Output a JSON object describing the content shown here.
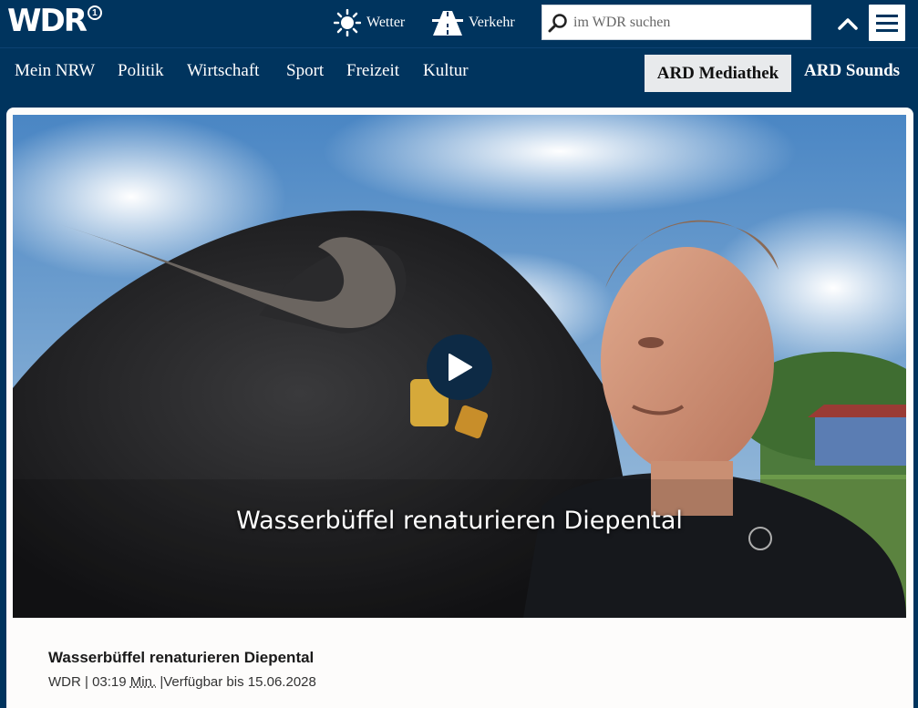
{
  "header": {
    "logo_text": "WDR",
    "logo_badge": "1",
    "services": {
      "weather_label": "Wetter",
      "traffic_label": "Verkehr"
    },
    "search": {
      "placeholder": "im WDR suchen"
    },
    "icons": {
      "weather": "sun-icon",
      "traffic": "highway-icon",
      "search": "magnifier-icon",
      "collapse": "chevron-up-icon",
      "menu": "hamburger-menu-icon"
    }
  },
  "nav": {
    "items": [
      {
        "label": "Mein NRW"
      },
      {
        "label": "Politik"
      },
      {
        "label": "Wirtschaft"
      },
      {
        "label": "Sport"
      },
      {
        "label": "Freizeit"
      },
      {
        "label": "Kultur"
      }
    ],
    "ard_mediathek": "ARD Mediathek",
    "ard_sounds": "ARD Sounds"
  },
  "video": {
    "overlay_title": "Wasserbüffel renaturieren Diepental",
    "title": "Wasserbüffel renaturieren Diepental",
    "source": "WDR",
    "duration": "03:19",
    "duration_unit": "Min.",
    "availability": "Verfügbar bis 15.06.2028",
    "separator": "|"
  },
  "colors": {
    "brand_dark_blue": "#00345e",
    "card_background": "#fdfcfb",
    "play_button": "#0d2a45"
  }
}
